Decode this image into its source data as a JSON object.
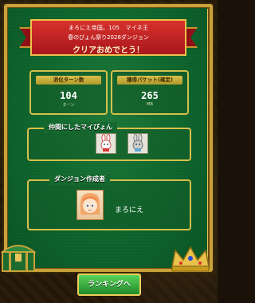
{
  "banner": {
    "line1": "まろにえ帝国。105　マイネ王",
    "line2": "春のぴょん祭り2026ダンジョン",
    "line3": "クリアおめでとう！"
  },
  "stats": {
    "turns": {
      "label": "消化ターン数",
      "value": "104",
      "unit": "ターン"
    },
    "packets": {
      "label": "獲得パケット(確定)",
      "value": "265",
      "unit": "MB"
    }
  },
  "companions": {
    "title": "仲間にしたマイぴょん",
    "items": [
      {
        "name": "red-bunny"
      },
      {
        "name": "blue-bunny"
      }
    ]
  },
  "creator": {
    "title": "ダンジョン作成者",
    "name": "まろにえ"
  },
  "ranking_button": {
    "label": "ランキングへ"
  },
  "colors": {
    "felt": "#116b30",
    "gold": "#d7c04c",
    "banner_red": "#c4222a",
    "button_green": "#2fa63a"
  }
}
